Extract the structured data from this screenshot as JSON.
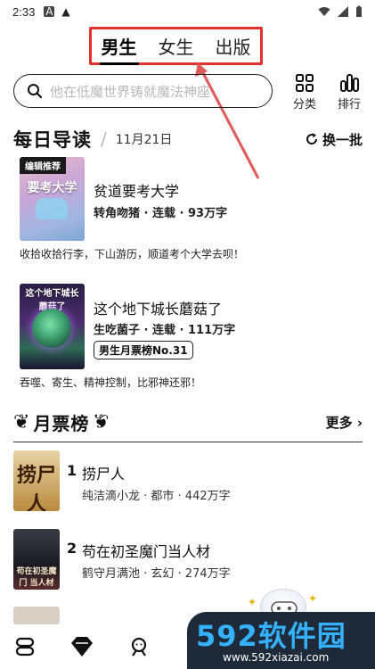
{
  "status_bar": {
    "time": "2:33",
    "icons": [
      "a-box-icon",
      "warning-icon",
      "wifi-icon",
      "signal-icon",
      "battery-icon"
    ]
  },
  "tabs": [
    {
      "label": "男生",
      "active": true
    },
    {
      "label": "女生",
      "active": false
    },
    {
      "label": "出版",
      "active": false
    }
  ],
  "search": {
    "placeholder": "他在低魔世界铸就魔法神座"
  },
  "top_actions": {
    "category": "分类",
    "rank": "排行"
  },
  "daily": {
    "title": "每日导读",
    "date": "11月21日",
    "refresh": "换一批",
    "books": [
      {
        "tag": "编辑推荐",
        "cover_text": "要考大学",
        "name": "贫道要考大学",
        "meta": "转角吻猪 · 连载 · 93万字",
        "desc": "收拾收拾行李，下山游历，顺道考个大学去呗！"
      },
      {
        "cover_text": "这个地下城长蘑菇了",
        "name": "这个地下城长蘑菇了",
        "meta": "生吃菌子 · 连载 · 111万字",
        "badge": "男生月票榜No.31",
        "desc": "吞噬、寄生、精神控制，比邪神还邪！"
      }
    ]
  },
  "rank": {
    "title": "月票榜",
    "more": "更多 ›",
    "items": [
      {
        "num": "1",
        "name": "捞尸人",
        "meta": "纯洁滴小龙 · 都市 · 442万字",
        "cover_text": "捞尸人"
      },
      {
        "num": "2",
        "name": "苟在初圣魔门当人材",
        "meta": "鹤守月满池 · 玄幻 · 274万字",
        "cover_text": "苟在初圣魔门 当人材"
      }
    ]
  },
  "watermark": {
    "brand": "592软件园",
    "url": "www.592xiazai.com"
  },
  "colors": {
    "highlight": "#e03030",
    "accent": "#35b2ff"
  }
}
